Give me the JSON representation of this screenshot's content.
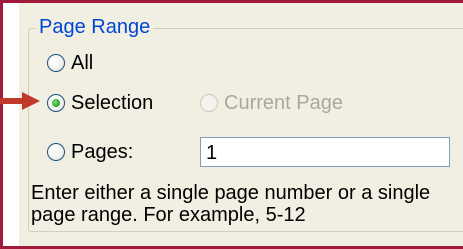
{
  "group": {
    "title": "Page Range"
  },
  "options": {
    "all": "All",
    "selection": "Selection",
    "current_page": "Current Page",
    "pages": "Pages:"
  },
  "pages_input": {
    "value": "1"
  },
  "help_text": "Enter either a single page number or a single page range.  For example, 5-12",
  "state": {
    "selected": "Selection",
    "disabled": [
      "Current Page"
    ]
  },
  "colors": {
    "group_title": "#0046d5",
    "annotation_arrow": "#c0392b",
    "frame_border": "#a01a3c",
    "dialog_background": "#f1efe2"
  }
}
